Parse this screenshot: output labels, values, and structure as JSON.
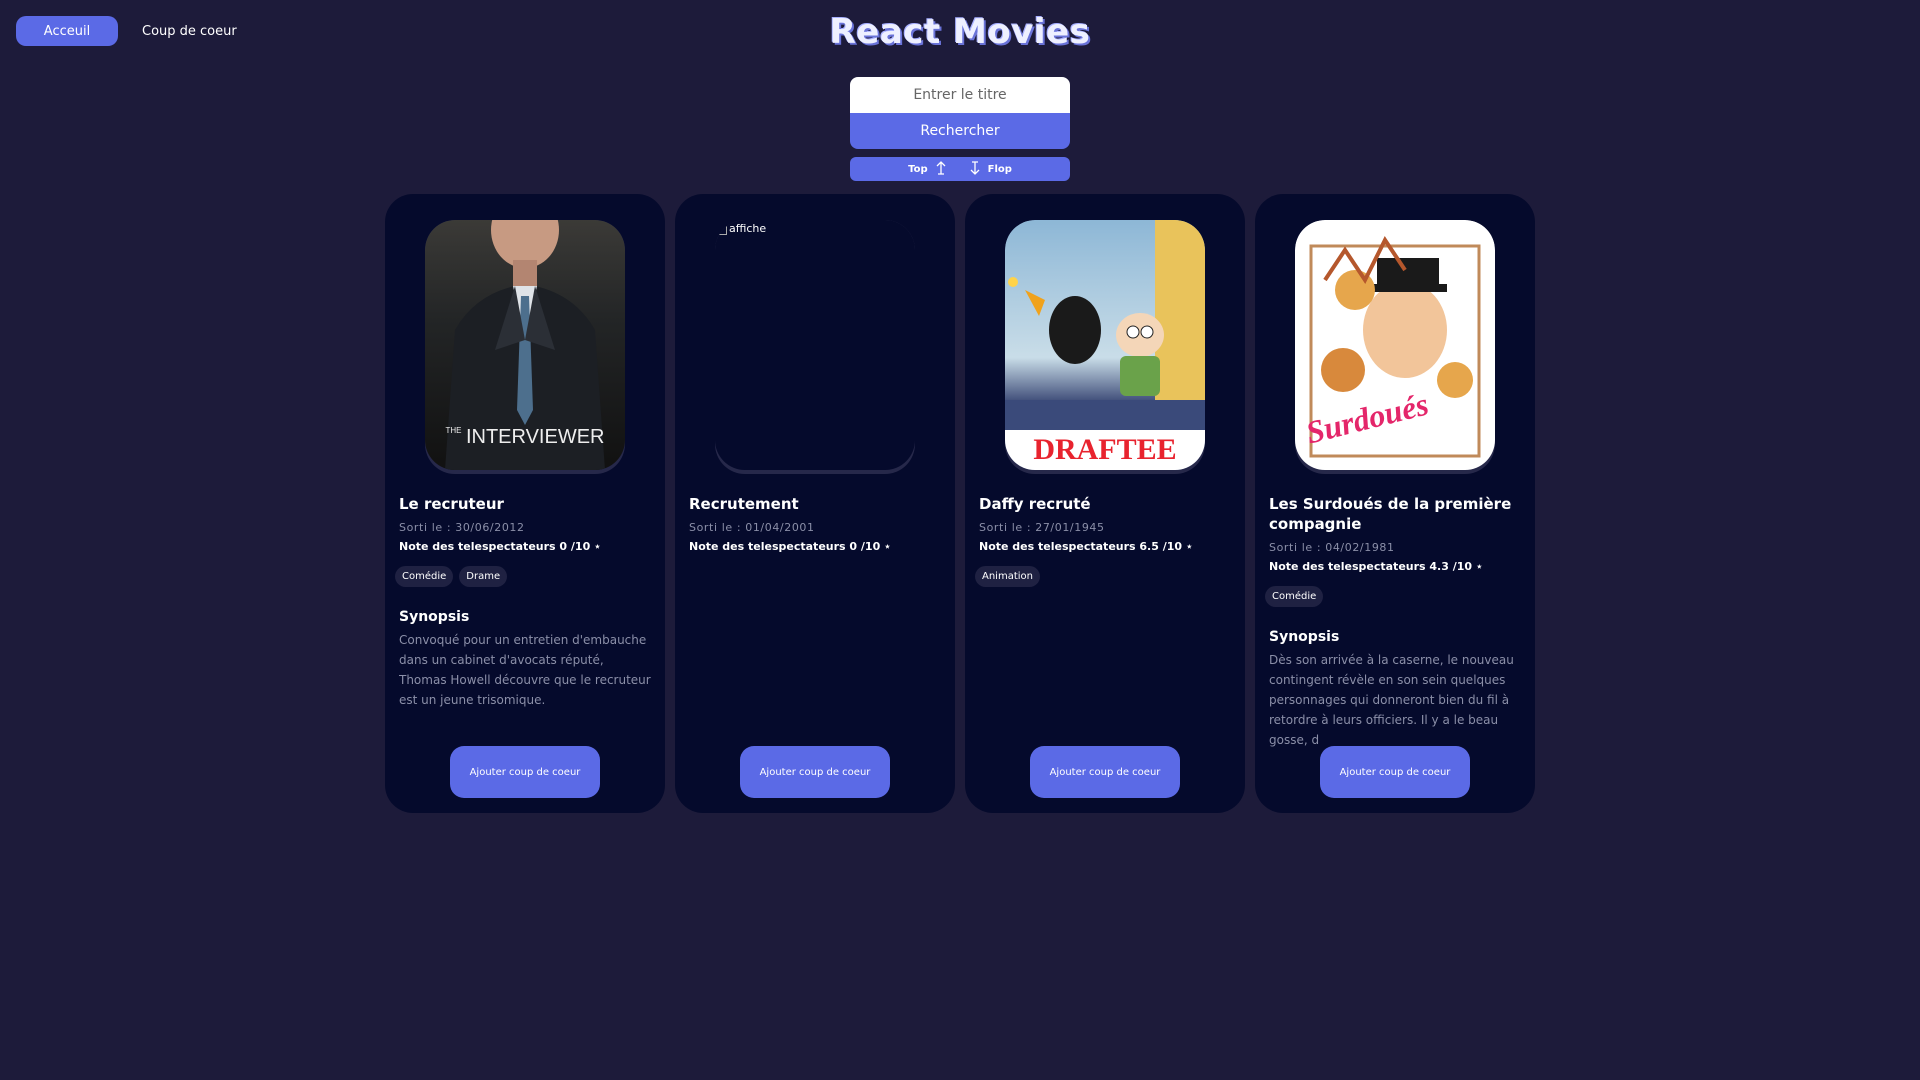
{
  "nav": {
    "home_label": "Acceuil",
    "favorites_label": "Coup de coeur"
  },
  "header": {
    "title": "React Movies"
  },
  "search": {
    "placeholder": "Entrer le titre",
    "button_label": "Rechercher"
  },
  "sort": {
    "top_label": "Top",
    "flop_label": "Flop",
    "top_icon": "arrow-up-icon",
    "flop_icon": "arrow-down-icon"
  },
  "colors": {
    "accent": "#5b6ae6",
    "background": "#1d1b3a",
    "card": "#050a2c"
  },
  "movies": [
    {
      "title": "Le recruteur",
      "release": "Sorti le : 30/06/2012",
      "rating": "Note des telespectateurs 0 /10 ⋆",
      "genres": [
        "Comédie",
        "Drame"
      ],
      "synopsis_title": "Synopsis",
      "synopsis": "Convoqué pour un entretien d'embauche dans un cabinet d'avocats réputé, Thomas Howell découvre que le recruteur est un jeune trisomique.",
      "poster_text": "INTERVIEWER",
      "poster_text_small": "THE",
      "button_label": "Ajouter coup de coeur"
    },
    {
      "title": "Recrutement",
      "release": "Sorti le : 01/04/2001",
      "rating": "Note des telespectateurs 0 /10 ⋆",
      "genres": [],
      "poster_alt": "affiche",
      "button_label": "Ajouter coup de coeur"
    },
    {
      "title": "Daffy recruté",
      "release": "Sorti le : 27/01/1945",
      "rating": "Note des telespectateurs 6.5 /10 ⋆",
      "genres": [
        "Animation"
      ],
      "poster_text": "DRAFTEE",
      "button_label": "Ajouter coup de coeur"
    },
    {
      "title": "Les Surdoués de la première compagnie",
      "release": "Sorti le : 04/02/1981",
      "rating": "Note des telespectateurs 4.3 /10 ⋆",
      "genres": [
        "Comédie"
      ],
      "synopsis_title": "Synopsis",
      "synopsis": "Dès son arrivée à la caserne, le nouveau contingent révèle en son sein quelques personnages qui donneront bien du fil à retordre à leurs officiers. Il y a le beau gosse, d",
      "poster_text": "Surdoués",
      "button_label": "Ajouter coup de coeur"
    }
  ]
}
